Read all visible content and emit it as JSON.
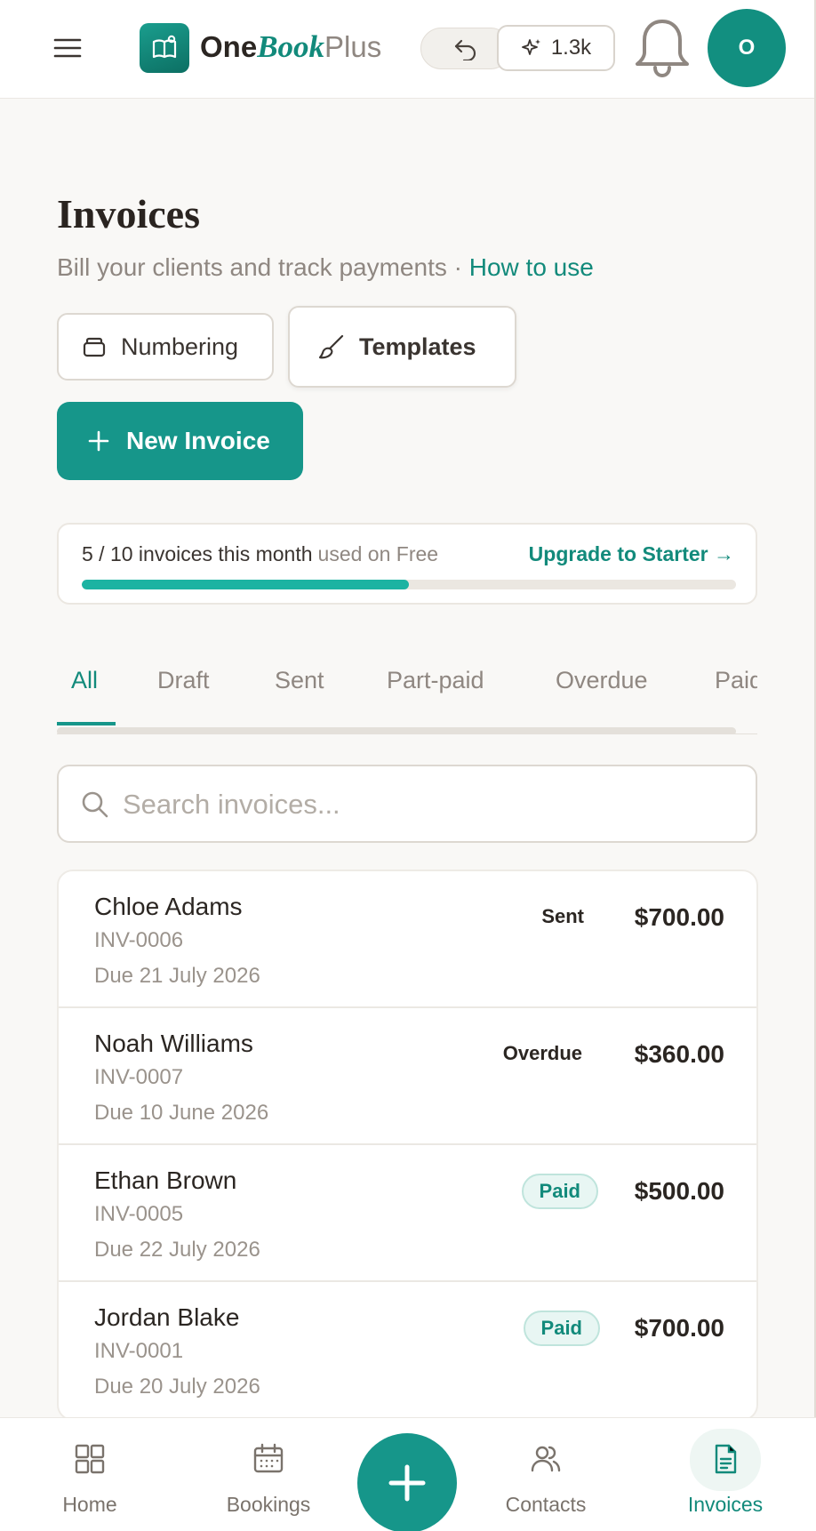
{
  "header": {
    "logo_one": "One",
    "logo_book": "Book",
    "logo_plus": "Plus",
    "spark_count": "1.3k",
    "avatar_initial": "O",
    "icons": [
      "menu-icon",
      "book-icon",
      "undo-icon",
      "sparkle-icon",
      "bell-icon"
    ]
  },
  "page": {
    "title": "Invoices",
    "subtitle": "Bill your clients and track payments · ",
    "how_to_link": "How to use"
  },
  "actions": {
    "numbering_label": "Numbering",
    "templates_label": "Templates",
    "new_invoice_label": "New Invoice"
  },
  "usage": {
    "count_text": "5 / 10 invoices this month",
    "plan_text": "used on Free",
    "upgrade_link": "Upgrade to Starter →",
    "used": 5,
    "limit": 10
  },
  "tabs": [
    {
      "label": "All",
      "active": true
    },
    {
      "label": "Draft",
      "active": false
    },
    {
      "label": "Sent",
      "active": false
    },
    {
      "label": "Part-paid",
      "active": false
    },
    {
      "label": "Overdue",
      "active": false
    },
    {
      "label": "Paid",
      "active": false
    }
  ],
  "search": {
    "placeholder": "Search invoices..."
  },
  "invoices": [
    {
      "client": "Chloe Adams",
      "number": "INV-0006",
      "due": "Due 21 July 2026",
      "status": "Sent",
      "amount": "$700.00"
    },
    {
      "client": "Noah Williams",
      "number": "INV-0007",
      "due": "Due 10 June 2026",
      "status": "Overdue",
      "amount": "$360.00"
    },
    {
      "client": "Ethan Brown",
      "number": "INV-0005",
      "due": "Due 22 July 2026",
      "status": "Paid",
      "amount": "$500.00"
    },
    {
      "client": "Jordan Blake",
      "number": "INV-0001",
      "due": "Due 20 July 2026",
      "status": "Paid",
      "amount": "$700.00"
    }
  ],
  "bottom_nav": [
    {
      "label": "Home",
      "icon": "home-grid-icon"
    },
    {
      "label": "Bookings",
      "icon": "calendar-icon"
    },
    {
      "label": "Contacts",
      "icon": "people-icon"
    },
    {
      "label": "Invoices",
      "icon": "document-icon",
      "active": true
    }
  ],
  "colors": {
    "accent": "#16968a",
    "accent_text": "#128a7b",
    "progress": "#1cb3a2",
    "paid_bg": "#e8f6f3"
  }
}
